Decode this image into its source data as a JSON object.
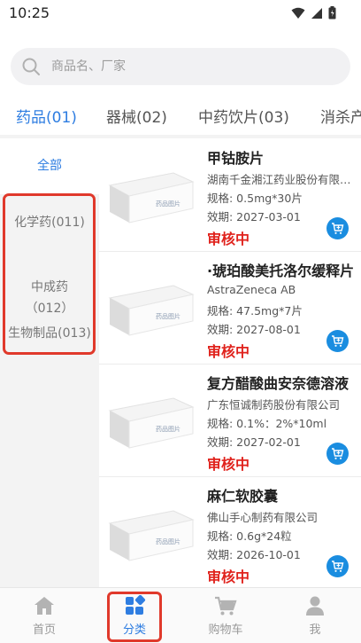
{
  "status_bar": {
    "time": "10:25"
  },
  "search": {
    "placeholder": "商品名、厂家"
  },
  "tabs": [
    {
      "label": "药品(01)",
      "active": true
    },
    {
      "label": "器械(02)",
      "active": false
    },
    {
      "label": "中药饮片(03)",
      "active": false
    },
    {
      "label": "消杀产",
      "active": false
    }
  ],
  "categories": [
    {
      "label": "全部",
      "active": true
    },
    {
      "label": "化学药(011)",
      "active": false
    },
    {
      "label": "中成药\n（012）",
      "active": false
    },
    {
      "label": "生物制品(013)",
      "active": false
    }
  ],
  "products": [
    {
      "name": "甲钴胺片",
      "maker": "湖南千金湘江药业股份有限公司",
      "spec": "规格: 0.5mg*30片",
      "expiry": "效期: 2027-03-01",
      "status": "审核中"
    },
    {
      "name": "·琥珀酸美托洛尔缓释片",
      "maker": "AstraZeneca AB",
      "spec": "规格: 47.5mg*7片",
      "expiry": "效期: 2027-08-01",
      "status": "审核中"
    },
    {
      "name": "复方醋酸曲安奈德溶液",
      "maker": "广东恒诚制药股份有限公司",
      "spec": "规格: 0.1%：2%*10ml",
      "expiry": "效期: 2027-02-01",
      "status": "审核中"
    },
    {
      "name": "麻仁软胶囊",
      "maker": "佛山手心制药有限公司",
      "spec": "规格: 0.6g*24粒",
      "expiry": "效期: 2026-10-01",
      "status": "审核中"
    }
  ],
  "thumb_label": "药品图片",
  "bottom_nav": [
    {
      "label": "首页",
      "icon": "home-icon",
      "active": false
    },
    {
      "label": "分类",
      "icon": "category-icon",
      "active": true
    },
    {
      "label": "购物车",
      "icon": "cart-icon",
      "active": false
    },
    {
      "label": "我",
      "icon": "profile-icon",
      "active": false
    }
  ],
  "colors": {
    "accent": "#2e7de1",
    "status_red": "#e0221c",
    "cart_button": "#1a8de0",
    "highlight_box": "#e0392b"
  }
}
